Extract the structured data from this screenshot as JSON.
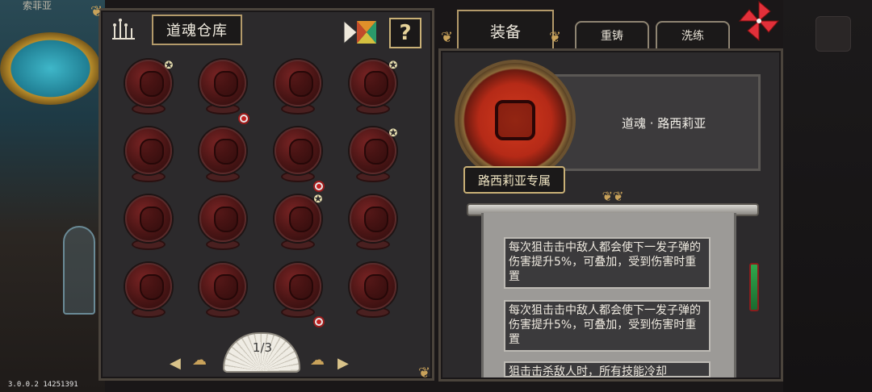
{
  "background": {
    "character_name": "索菲亚",
    "version": "3.0.0.2 14251391"
  },
  "warehouse": {
    "title": "道魂仓库",
    "pager": {
      "current": 1,
      "total": 3,
      "label": "1/3"
    }
  },
  "souls": [
    {
      "row": 0,
      "col": 0,
      "star": true,
      "badge": false
    },
    {
      "row": 0,
      "col": 1,
      "star": false,
      "badge": true
    },
    {
      "row": 0,
      "col": 2,
      "star": false,
      "badge": false
    },
    {
      "row": 0,
      "col": 3,
      "star": true,
      "badge": false
    },
    {
      "row": 1,
      "col": 0,
      "star": false,
      "badge": false
    },
    {
      "row": 1,
      "col": 1,
      "star": false,
      "badge": false
    },
    {
      "row": 1,
      "col": 2,
      "star": false,
      "badge": true
    },
    {
      "row": 1,
      "col": 3,
      "star": true,
      "badge": false
    },
    {
      "row": 2,
      "col": 0,
      "star": false,
      "badge": false
    },
    {
      "row": 2,
      "col": 1,
      "star": false,
      "badge": false
    },
    {
      "row": 2,
      "col": 2,
      "star": true,
      "badge": false
    },
    {
      "row": 2,
      "col": 3,
      "star": false,
      "badge": false
    },
    {
      "row": 3,
      "col": 0,
      "star": false,
      "badge": false
    },
    {
      "row": 3,
      "col": 1,
      "star": false,
      "badge": false
    },
    {
      "row": 3,
      "col": 2,
      "star": false,
      "badge": true
    },
    {
      "row": 3,
      "col": 3,
      "star": false,
      "badge": false
    }
  ],
  "tabs": {
    "equip": "装备",
    "reforge": "重铸",
    "wash": "洗练"
  },
  "detail": {
    "soul_name": "道魂 · 路西莉亚",
    "exclusive_label": "路西莉亚专属",
    "descriptions": [
      "每次狙击击中敌人都会使下一发子弹的伤害提升5%，可叠加，受到伤害时重置",
      "每次狙击击中敌人都会使下一发子弹的伤害提升5%，可叠加，受到伤害时重置",
      "狙击击杀敌人时，所有技能冷却"
    ]
  },
  "icons": {
    "settings": "candelabra-icon",
    "sort": "sort-icon",
    "help": "?",
    "close": "pinwheel-close-icon"
  },
  "colors": {
    "panel": "#2c2a2c",
    "border_gold": "#c9b076",
    "orb_red": "#b52a17"
  }
}
